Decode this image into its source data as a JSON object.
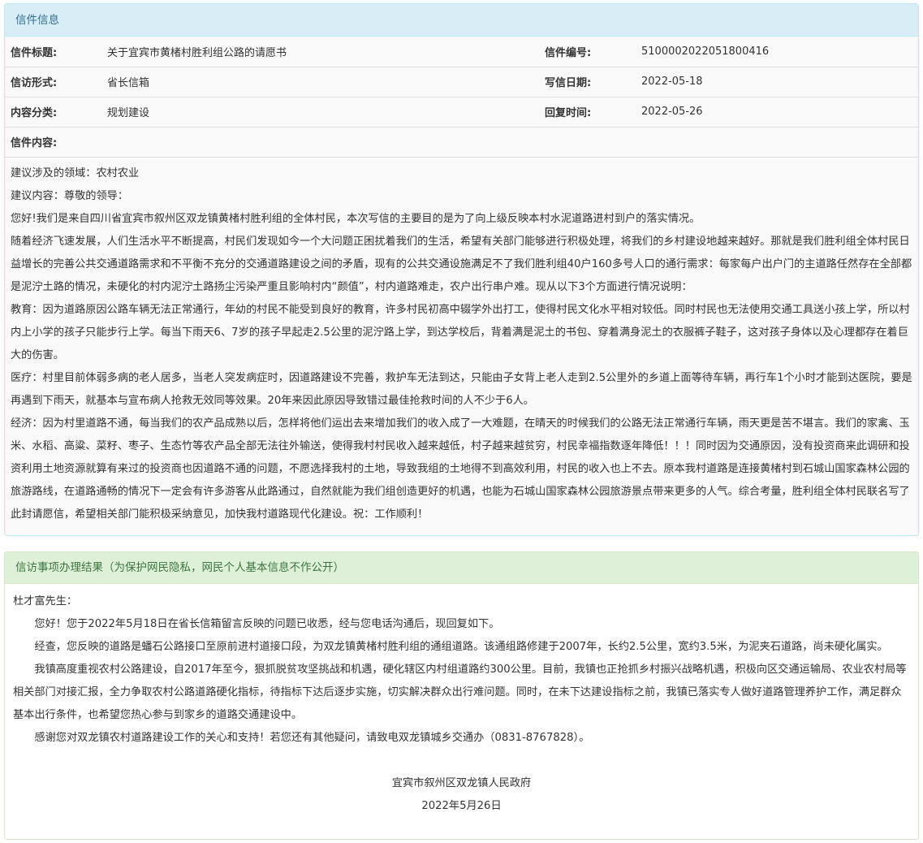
{
  "info_panel": {
    "heading": "信件信息",
    "rows": [
      {
        "label1": "信件标题:",
        "value1": "关于宜宾市黄楮村胜利组公路的请愿书",
        "label2": "信件编号:",
        "value2": "5100002022051800416"
      },
      {
        "label1": "信访形式:",
        "value1": "省长信箱",
        "label2": "写信日期:",
        "value2": "2022-05-18"
      },
      {
        "label1": "内容分类:",
        "value1": "规划建设",
        "label2": "回复时间:",
        "value2": "2022-05-26"
      }
    ],
    "content_label": "信件内容:",
    "content_paragraphs": [
      "建议涉及的领域：农村农业",
      "建议内容：尊敬的领导：",
      "您好!我们是来自四川省宜宾市叙州区双龙镇黄楮村胜利组的全体村民，本次写信的主要目的是为了向上级反映本村水泥道路进村到户的落实情况。",
      "随着经济飞速发展，人们生活水平不断提高，村民们发现如今一个大问题正困扰着我们的生活，希望有关部门能够进行积极处理，将我们的乡村建设地越来越好。那就是我们胜利组全体村民日益增长的完善公共交通道路需求和不平衡不充分的交通道路建设之间的矛盾，现有的公共交通设施满足不了我们胜利组40户160多号人口的通行需求：每家每户出户门的主道路任然存在全部都是泥泞土路的情况，未硬化的村内泥泞土路扬尘污染严重且影响村内“颜值”，村内道路难走，农户出行串户难。现从以下3个方面进行情况说明：",
      "教育：因为道路原因公路车辆无法正常通行，年幼的村民不能受到良好的教育，许多村民初高中辍学外出打工，使得村民文化水平相对较低。同时村民也无法使用交通工具送小孩上学，所以村内上小学的孩子只能步行上学。每当下雨天6、7岁的孩子早起走2.5公里的泥泞路上学，到达学校后，背着满是泥土的书包、穿着满身泥土的衣服裤子鞋子，这对孩子身体以及心理都存在着巨大的伤害。",
      "医疗：村里目前体弱多病的老人居多，当老人突发病症时，因道路建设不完善，救护车无法到达，只能由子女背上老人走到2.5公里外的乡道上面等待车辆，再行车1个小时才能到达医院，要是再遇到下雨天，就基本与宣布病人抢救无效同等效果。20年来因此原因导致错过最佳抢救时间的人不少于6人。",
      "经济：因为村里道路不通，每当我们的农产品成熟以后，怎样将他们运出去来增加我们的收入成了一大难题，在晴天的时候我们的公路无法正常通行车辆，雨天更是苦不堪言。我们的家禽、玉米、水稻、高粱、菜籽、枣子、生态竹等农产品全部无法往外输送，使得我村村民收入越来越低，村子越来越贫穷，村民幸福指数逐年降低！！！同时因为交通原因，没有投资商来此调研和投资利用土地资源就算有来过的投资商也因道路不通的问题，不愿选择我村的土地，导致我组的土地得不到高效利用，村民的收入也上不去。原本我村道路是连接黄楮村到石城山国家森林公园的旅游路线，在道路通畅的情况下一定会有许多游客从此路通过，自然就能为我们组创造更好的机遇，也能为石城山国家森林公园旅游景点带来更多的人气。综合考量，胜利组全体村民联名写了此封请愿信，希望相关部门能积极采纳意见，加快我村道路现代化建设。祝：工作顺利！"
    ]
  },
  "result_panel": {
    "heading": "信访事项办理结果（为保护网民隐私，网民个人基本信息不作公开）",
    "salutation": "杜才富先生：",
    "paragraphs": [
      "您好！您于2022年5月18日在省长信箱留言反映的问题已收悉，经与您电话沟通后，现回复如下。",
      "经查，您反映的道路是蟠石公路接口至原前进村道接口段，为双龙镇黄楮村胜利组的通组道路。该通组路修建于2007年，长约2.5公里，宽约3.5米，为泥夹石道路，尚未硬化属实。",
      "我镇高度重视农村公路建设，自2017年至今，狠抓脱贫攻坚挑战和机遇，硬化辖区内村组道路约300公里。目前，我镇也正抢抓乡村振兴战略机遇，积极向区交通运输局、农业农村局等相关部门对接汇报，全力争取农村公路道路硬化指标，待指标下达后逐步实施，切实解决群众出行难问题。同时，在未下达建设指标之前，我镇已落实专人做好道路管理养护工作，满足群众基本出行条件，也希望您热心参与到家乡的道路交通建设中。",
      "感谢您对双龙镇农村道路建设工作的关心和支持！若您还有其他疑问，请致电双龙镇城乡交通办（0831-8767828）。"
    ],
    "signature": "宜宾市叙州区双龙镇人民政府",
    "date": "2022年5月26日"
  }
}
